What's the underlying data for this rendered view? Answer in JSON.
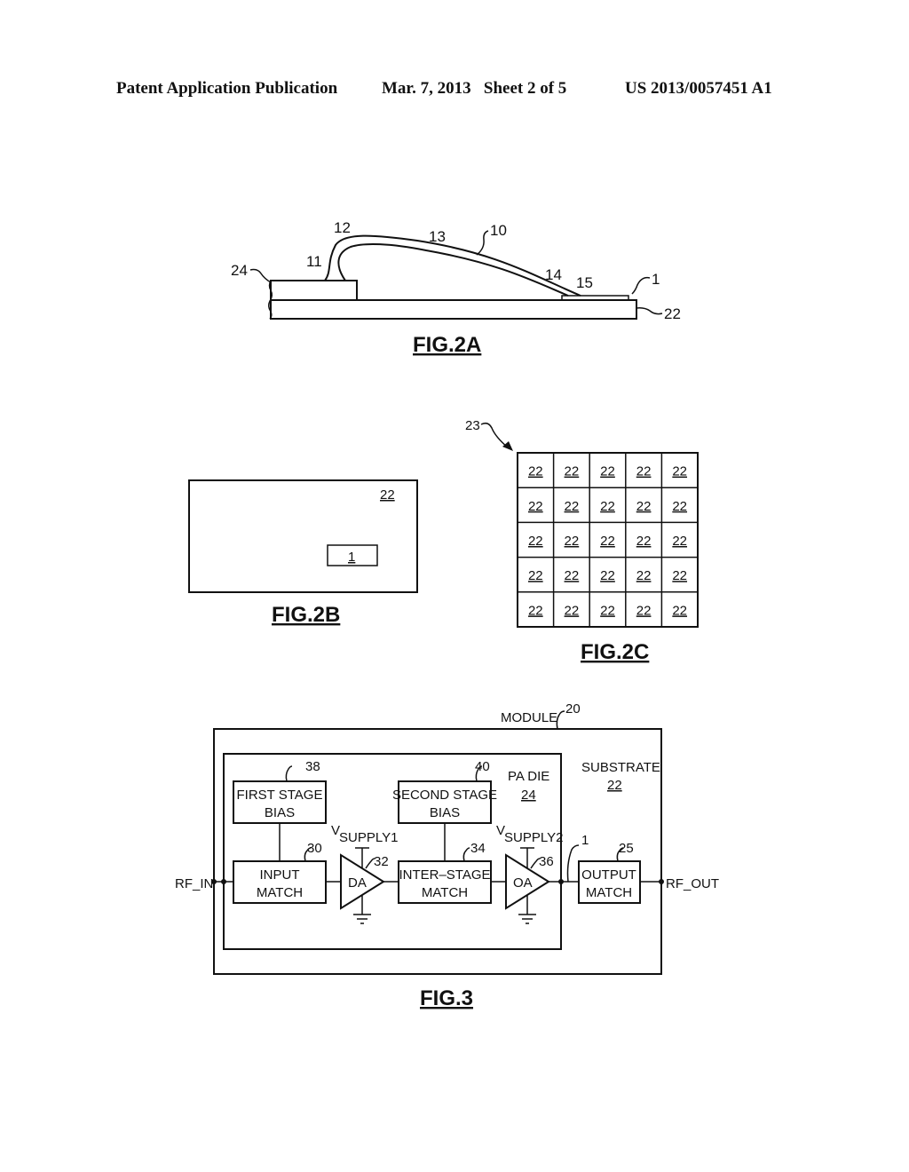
{
  "header": {
    "left": "Patent Application Publication",
    "middle": "Mar. 7, 2013   Sheet 2 of 5",
    "right": "US 2013/0057451 A1"
  },
  "fig2a": {
    "caption": "FIG.2A",
    "labels": {
      "wire": "10",
      "seg11": "11",
      "seg12": "12",
      "seg13": "13",
      "seg14": "14",
      "seg15": "15",
      "pad": "1",
      "substrate": "22",
      "die": "24"
    }
  },
  "fig2b": {
    "caption": "FIG.2B",
    "substrate_label": "22",
    "pad_label": "1"
  },
  "fig2c": {
    "caption": "FIG.2C",
    "array_label": "23",
    "rows": 5,
    "cols": 5,
    "cell_label": "22"
  },
  "fig3": {
    "caption": "FIG.3",
    "module_label": "MODULE",
    "module_ref": "20",
    "substrate_label": "SUBSTRATE",
    "substrate_ref": "22",
    "die_label": "PA DIE",
    "die_ref": "24",
    "first_bias": {
      "line1": "FIRST STAGE",
      "line2": "BIAS",
      "ref": "38"
    },
    "second_bias": {
      "line1": "SECOND STAGE",
      "line2": "BIAS",
      "ref": "40"
    },
    "input_match": {
      "line1": "INPUT",
      "line2": "MATCH",
      "ref": "30"
    },
    "driver_amp": {
      "label": "DA",
      "ref": "32"
    },
    "interstage": {
      "line1": "INTER–STAGE",
      "line2": "MATCH",
      "ref": "34"
    },
    "output_amp": {
      "label": "OA",
      "ref": "36"
    },
    "output_match": {
      "line1": "OUTPUT",
      "line2": "MATCH",
      "ref": "25"
    },
    "pad_ref": "1",
    "vsupply1": {
      "v": "V",
      "sub": "SUPPLY1"
    },
    "vsupply2": {
      "v": "V",
      "sub": "SUPPLY2"
    },
    "rf_in": "RF_IN",
    "rf_out": "RF_OUT"
  }
}
